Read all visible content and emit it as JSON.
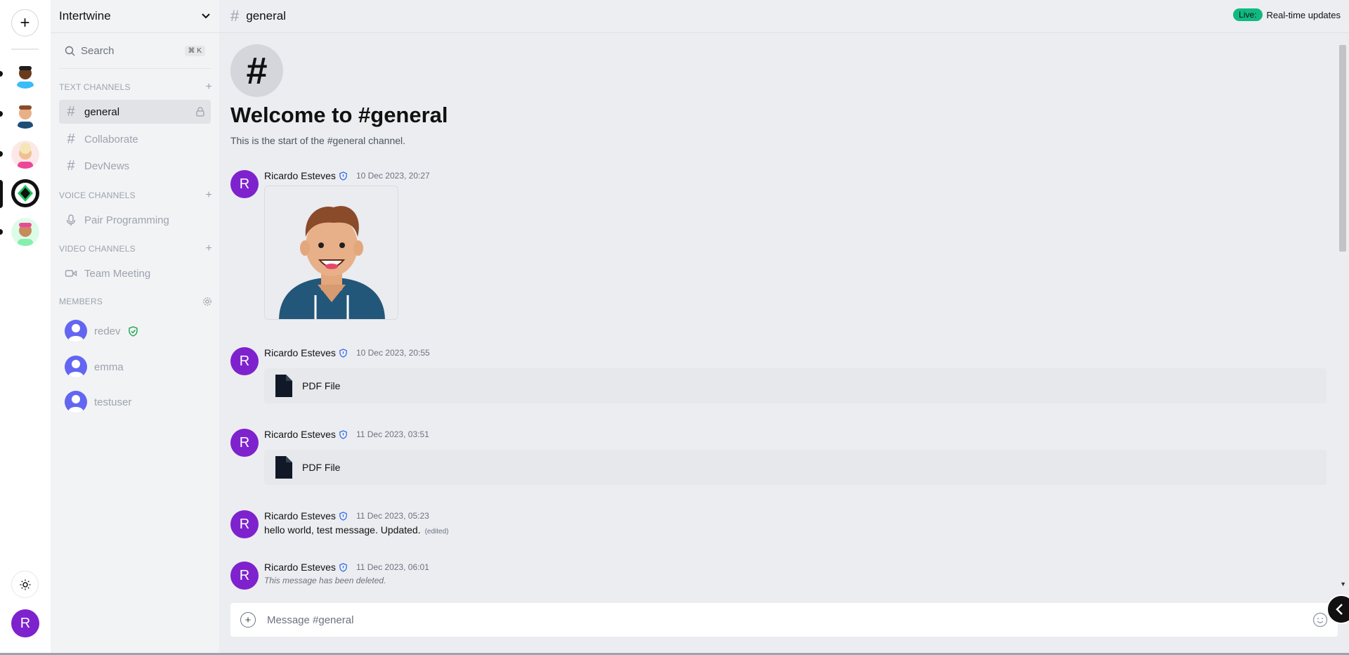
{
  "app": {
    "server_name": "Intertwine",
    "add_server_label": "+",
    "user_initial": "R"
  },
  "sidebar": {
    "search_placeholder": "Search",
    "search_shortcut": "⌘ K",
    "text_channels_header": "TEXT CHANNELS",
    "voice_channels_header": "VOICE CHANNELS",
    "video_channels_header": "VIDEO CHANNELS",
    "members_header": "MEMBERS",
    "text_channels": [
      "general",
      "Collaborate",
      "DevNews"
    ],
    "voice_channels": [
      "Pair Programming"
    ],
    "video_channels": [
      "Team Meeting"
    ],
    "members": [
      "redev",
      "emma",
      "testuser"
    ]
  },
  "topbar": {
    "channel": "general",
    "live_badge": "Live:",
    "live_text": "Real-time updates"
  },
  "welcome": {
    "icon": "#",
    "title": "Welcome to #general",
    "subtitle": "This is the start of the #general channel."
  },
  "messages": [
    {
      "initial": "R",
      "author": "Ricardo Esteves",
      "time": "10 Dec 2023, 20:27",
      "type": "image"
    },
    {
      "initial": "R",
      "author": "Ricardo Esteves",
      "time": "10 Dec 2023, 20:55",
      "type": "file",
      "file_label": "PDF File"
    },
    {
      "initial": "R",
      "author": "Ricardo Esteves",
      "time": "11 Dec 2023, 03:51",
      "type": "file",
      "file_label": "PDF File"
    },
    {
      "initial": "R",
      "author": "Ricardo Esteves",
      "time": "11 Dec 2023, 05:23",
      "type": "text",
      "text": "hello world, test message. Updated.",
      "edited": "(edited)"
    },
    {
      "initial": "R",
      "author": "Ricardo Esteves",
      "time": "11 Dec 2023, 06:01",
      "type": "deleted",
      "text": "This message has been deleted."
    }
  ],
  "composer": {
    "placeholder": "Message #general",
    "add_label": "+"
  },
  "colors": {
    "accent_purple": "#7e22ce",
    "live_green": "#10b981",
    "member_avatar": "#6366f1",
    "verified_green": "#16a34a"
  }
}
